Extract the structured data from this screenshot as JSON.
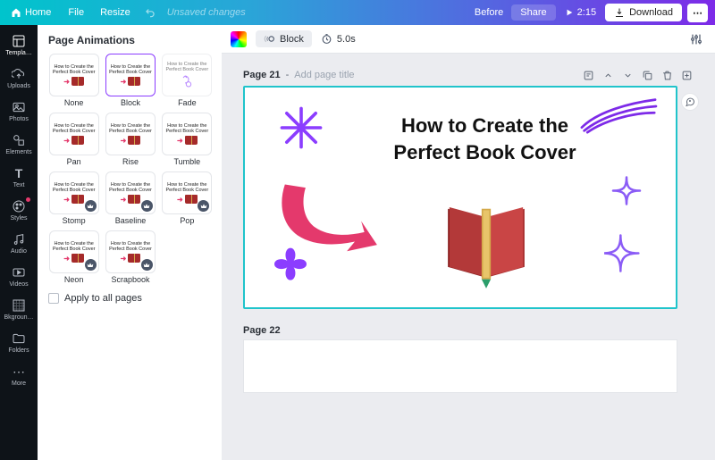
{
  "topbar": {
    "home": "Home",
    "file": "File",
    "resize": "Resize",
    "unsaved": "Unsaved changes",
    "before": "Before",
    "share": "Share",
    "play_time": "2:15",
    "download": "Download"
  },
  "rail": {
    "templates": "Templa…",
    "uploads": "Uploads",
    "photos": "Photos",
    "elements": "Elements",
    "text": "Text",
    "styles": "Styles",
    "audio": "Audio",
    "videos": "Videos",
    "bkground": "Bkgroun…",
    "folders": "Folders",
    "more": "More"
  },
  "panel": {
    "title": "Page Animations",
    "thumb_line1": "How to Create the",
    "thumb_line2": "Perfect Book Cover",
    "items": [
      {
        "label": "None",
        "premium": false,
        "selected": false
      },
      {
        "label": "Block",
        "premium": false,
        "selected": true
      },
      {
        "label": "Fade",
        "premium": false,
        "selected": false
      },
      {
        "label": "Pan",
        "premium": false,
        "selected": false
      },
      {
        "label": "Rise",
        "premium": false,
        "selected": false
      },
      {
        "label": "Tumble",
        "premium": false,
        "selected": false
      },
      {
        "label": "Stomp",
        "premium": true,
        "selected": false
      },
      {
        "label": "Baseline",
        "premium": true,
        "selected": false
      },
      {
        "label": "Pop",
        "premium": true,
        "selected": false
      },
      {
        "label": "Neon",
        "premium": true,
        "selected": false
      },
      {
        "label": "Scrapbook",
        "premium": true,
        "selected": false
      }
    ],
    "apply_all": "Apply to all pages"
  },
  "toolbar": {
    "block": "Block",
    "duration": "5.0s"
  },
  "canvas": {
    "page_label": "Page 21",
    "page_title_placeholder": "Add page title",
    "headline_l1": "How to Create the",
    "headline_l2": "Perfect Book Cover",
    "page2_label": "Page 22"
  }
}
